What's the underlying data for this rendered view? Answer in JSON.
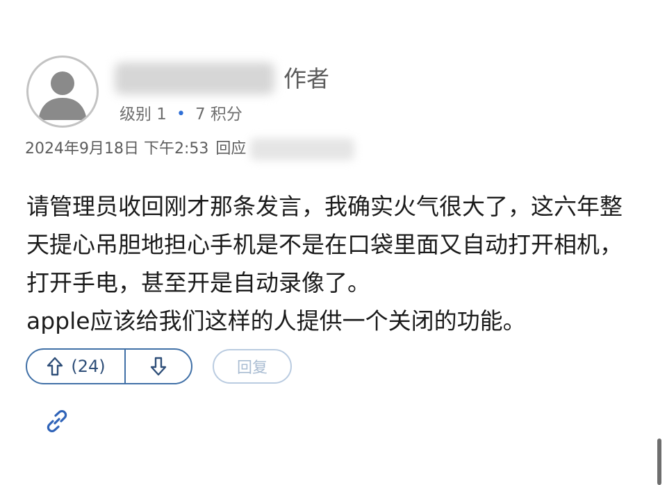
{
  "comment": {
    "author_tag": "作者",
    "level_text": "级别 1",
    "separator": "•",
    "points_text": "7 积分",
    "timestamp": "2024年9月18日 下午2:53",
    "reply_to_label": "回应",
    "body_lines": [
      "请管理员收回刚才那条发言，我确实火气很大了，这六年整",
      "天提心吊胆地担心手机是不是在口袋里面又自动打开相机，",
      "打开手电，甚至开是自动录像了。",
      "apple应该给我们这样的人提供一个关闭的功能。"
    ]
  },
  "actions": {
    "upvote_count": "(24)",
    "reply_label": "回复"
  },
  "icons": {
    "avatar": "default-user-avatar-icon",
    "upvote": "arrow-up-icon",
    "downvote": "arrow-down-icon",
    "link": "link-icon"
  },
  "colors": {
    "accent": "#3f6fa6",
    "dot": "#2f6fd6",
    "reply_border": "#b9cbe0",
    "reply_text": "#a9bcd2"
  }
}
